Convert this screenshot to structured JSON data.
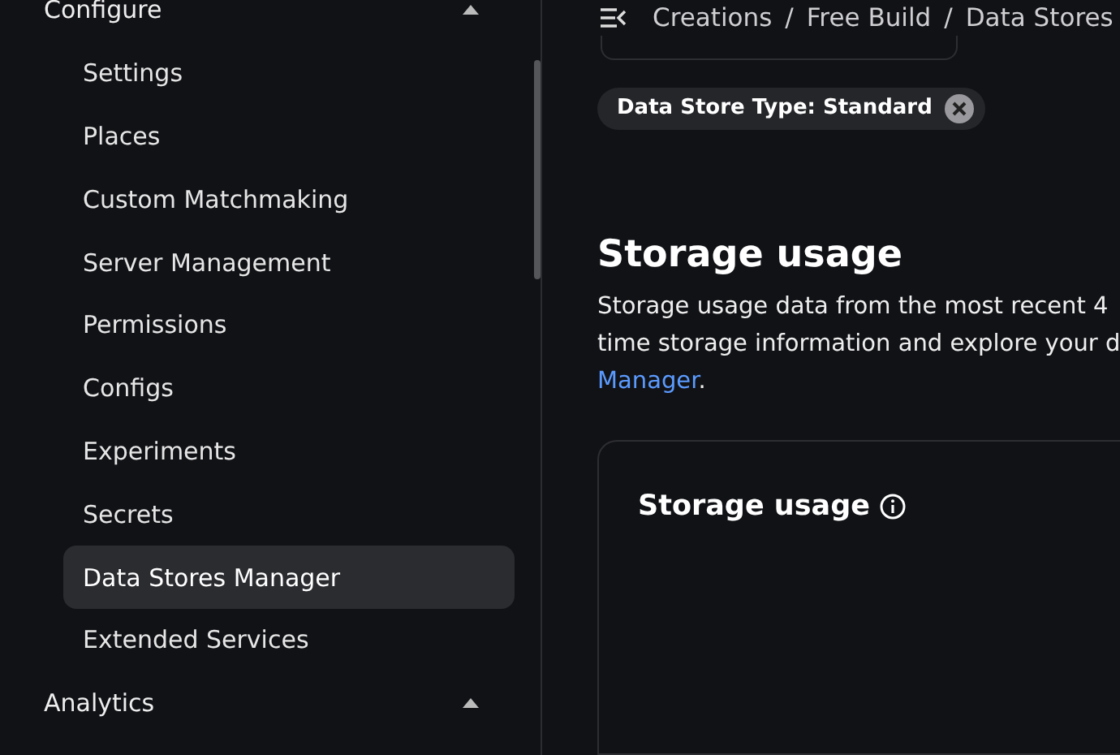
{
  "sidebar": {
    "sections": [
      {
        "title": "Configure",
        "expanded": true,
        "items": [
          {
            "label": "Settings",
            "selected": false
          },
          {
            "label": "Places",
            "selected": false
          },
          {
            "label": "Custom Matchmaking",
            "selected": false
          },
          {
            "label": "Server Management",
            "selected": false
          },
          {
            "label": "Permissions",
            "selected": false
          },
          {
            "label": "Configs",
            "selected": false
          },
          {
            "label": "Experiments",
            "selected": false
          },
          {
            "label": "Secrets",
            "selected": false
          },
          {
            "label": "Data Stores Manager",
            "selected": true
          },
          {
            "label": "Extended Services",
            "selected": false
          }
        ]
      },
      {
        "title": "Analytics",
        "expanded": true
      }
    ]
  },
  "breadcrumb": {
    "separator": "/",
    "items": [
      "Creations",
      "Free Build",
      "Data Stores"
    ]
  },
  "filter_chip": {
    "label": "Data Store Type: Standard"
  },
  "storage": {
    "heading": "Storage usage",
    "description": {
      "lines": [
        "Storage usage data from the most recent 4",
        "time storage information and explore your d"
      ],
      "link": "Manager",
      "tail": "."
    },
    "card": {
      "title": "Storage usage"
    }
  }
}
